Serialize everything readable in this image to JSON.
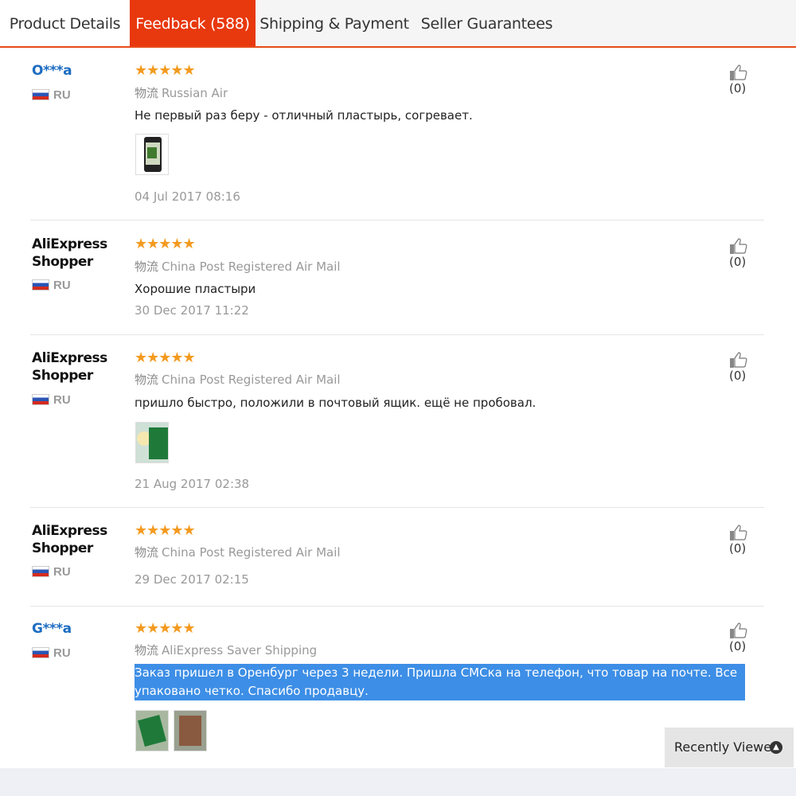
{
  "tabs": [
    {
      "label": "Product Details"
    },
    {
      "label": "Feedback (588)"
    },
    {
      "label": "Shipping & Payment"
    },
    {
      "label": "Seller Guarantees"
    }
  ],
  "logistics_label": "物流",
  "stars": "★★★★★",
  "reviews": [
    {
      "user": "O***a",
      "country": "RU",
      "logistics": "Russian Air",
      "text": "Не первый раз беру - отличный пластырь, согревает.",
      "date": "04 Jul 2017 08:16",
      "likes": "(0)"
    },
    {
      "user": "AliExpress Shopper",
      "country": "RU",
      "logistics": "China Post Registered Air Mail",
      "text": "Хорошие пластыри",
      "date": "30 Dec 2017 11:22",
      "likes": "(0)"
    },
    {
      "user": "AliExpress Shopper",
      "country": "RU",
      "logistics": "China Post Registered Air Mail",
      "text": "пришло быстро, положили в почтовый ящик. ещё не пробовал.",
      "date": "21 Aug 2017 02:38",
      "likes": "(0)"
    },
    {
      "user": "AliExpress Shopper",
      "country": "RU",
      "logistics": "China Post Registered Air Mail",
      "text": "",
      "date": "29 Dec 2017 02:15",
      "likes": "(0)"
    },
    {
      "user": "G***a",
      "country": "RU",
      "logistics": "AliExpress Saver Shipping",
      "text": "Заказ пришел в Оренбург через 3 недели. Пришла СМСка на телефон, что товар на почте. Все упаковано четко. Спасибо продавцу.",
      "date": "",
      "likes": "(0)"
    }
  ],
  "recently_viewed": "Recently Viewed",
  "colors": {
    "accent": "#e8380d",
    "star": "#f39a1f",
    "link": "#1c6cc1",
    "selection": "#3d8ee6"
  }
}
